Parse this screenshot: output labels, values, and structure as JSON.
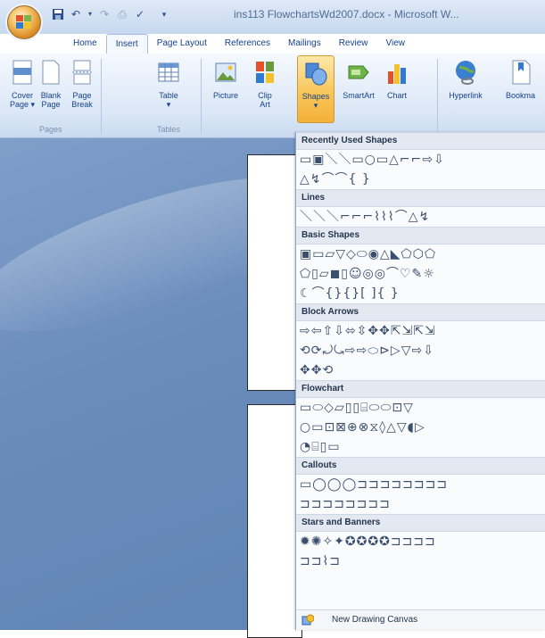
{
  "window": {
    "title": "ins113 FlowchartsWd2007.docx - Microsoft W..."
  },
  "tabs": [
    {
      "label": "Home"
    },
    {
      "label": "Insert"
    },
    {
      "label": "Page Layout"
    },
    {
      "label": "References"
    },
    {
      "label": "Mailings"
    },
    {
      "label": "Review"
    },
    {
      "label": "View"
    }
  ],
  "ribbon": {
    "buttons": {
      "cover_page": "Cover\nPage ▾",
      "blank_page": "Blank\nPage",
      "page_break": "Page\nBreak",
      "table": "Table\n▾",
      "picture": "Picture",
      "clip_art": "Clip\nArt",
      "shapes": "Shapes\n▾",
      "smartart": "SmartArt",
      "chart": "Chart",
      "hyperlink": "Hyperlink",
      "bookmark": "Bookma"
    },
    "groups": {
      "pages": "Pages",
      "tables": "Tables"
    }
  },
  "gallery": {
    "sections": [
      {
        "title": "Recently Used Shapes",
        "rows": [
          "▭▣＼＼▭○▭△⌐⌐⇨⇩",
          "△↯⌒⌒{ }"
        ]
      },
      {
        "title": "Lines",
        "rows": [
          "＼＼＼⌐⌐⌐⌇⌇⌇⌒△↯"
        ]
      },
      {
        "title": "Basic Shapes",
        "rows": [
          "▣▭▱▽◇⬭◉△◣⬠⬡⬠",
          "⬠▯▱◼▯☺◎◎⌒♡✎☼",
          "☾⌒{}{}[ ]{ }"
        ]
      },
      {
        "title": "Block Arrows",
        "rows": [
          "⇨⇦⇧⇩⬄⇳✥✥⇱⇲⇱⇲",
          "⟲⟳⤾⤿⇨⇨⬭⊳▷▽⇨⇩",
          "✥✥⟲"
        ]
      },
      {
        "title": "Flowchart",
        "rows": [
          "▭⬭◇▱▯▯⌸⬭⬭⊡▽",
          "○▭⊡⊠⊕⊗⧖◊△▽◖▷",
          "◔⌸▯▭"
        ]
      },
      {
        "title": "Callouts",
        "rows": [
          "▭◯◯◯⊐⊐⊐⊐⊐⊐⊐⊐",
          "⊐⊐⊐⊐⊐⊐⊐⊐"
        ]
      },
      {
        "title": "Stars and Banners",
        "rows": [
          "✹✺✧✦✪✪✪✪⊐⊐⊐⊐",
          "⊐⊐⌇⊐"
        ]
      }
    ],
    "footer": "New Drawing Canvas"
  }
}
